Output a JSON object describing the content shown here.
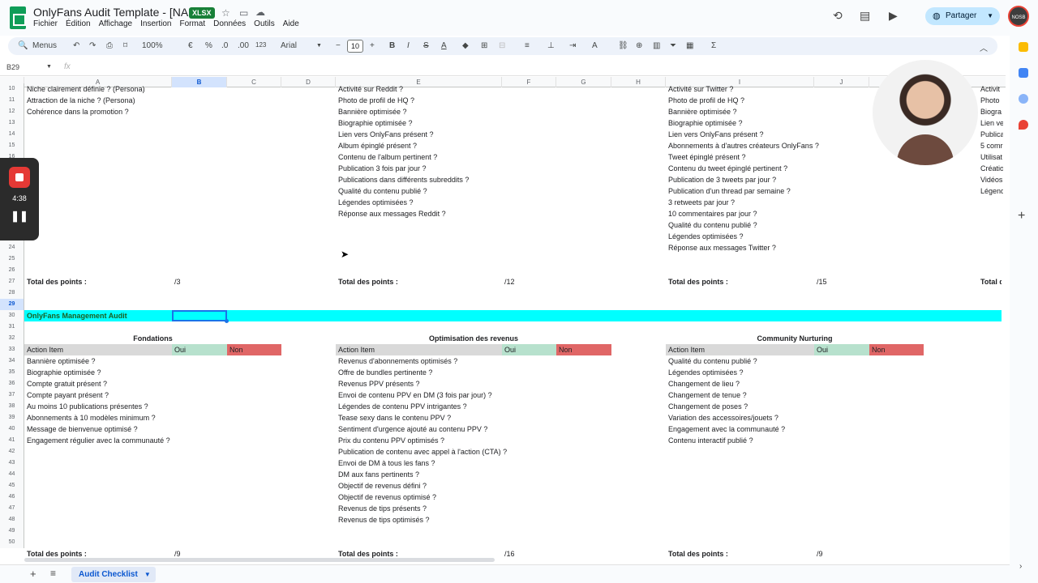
{
  "app": {
    "doc_title": "OnlyFans Audit Template - [NAME]",
    "file_badge": "XLSX",
    "menu": [
      "Fichier",
      "Édition",
      "Affichage",
      "Insertion",
      "Format",
      "Données",
      "Outils",
      "Aide"
    ],
    "share_label": "Partager",
    "avatar_text": "NOSB"
  },
  "toolbar": {
    "search_label": "Menus",
    "zoom": "100%",
    "currency": "€",
    "percent": "%",
    "dec_less": ".0",
    "dec_more": ".00",
    "number_format": "123",
    "font": "Arial",
    "font_size": "10",
    "minus": "−",
    "plus": "+"
  },
  "formula_bar": {
    "cell_ref": "B29",
    "fx": "fx",
    "value": ""
  },
  "columns": [
    "A",
    "B",
    "C",
    "D",
    "E",
    "F",
    "G",
    "H",
    "I",
    "J"
  ],
  "selected_column": "B",
  "rows": [
    "10",
    "11",
    "12",
    "13",
    "14",
    "15",
    "16",
    "17",
    "18",
    "19",
    "20",
    "21",
    "22",
    "23",
    "24",
    "25",
    "26",
    "27",
    "28",
    "29",
    "30",
    "31",
    "32",
    "33",
    "34",
    "35",
    "36",
    "37",
    "38",
    "39",
    "40",
    "41",
    "42",
    "43",
    "44",
    "45",
    "46",
    "47",
    "48",
    "49",
    "50"
  ],
  "selected_row": "29",
  "top": {
    "col_a": [
      "Niche clairement définie ? (Persona)",
      "Attraction de la niche ? (Persona)",
      "Cohérence dans la promotion ?"
    ],
    "col_e": [
      "Activité sur Reddit ?",
      "Photo de profil de HQ ?",
      "Bannière optimisée ?",
      "Biographie optimisée ?",
      "Lien vers OnlyFans présent ?",
      "Album épinglé présent ?",
      "Contenu de l'album pertinent ?",
      "Publication 3 fois par jour ?",
      "Publications dans différents subreddits ?",
      "Qualité du contenu publié ?",
      "Légendes optimisées ?",
      "Réponse aux messages Reddit ?"
    ],
    "col_i": [
      "Activité sur Twitter ?",
      "Photo de profil de HQ ?",
      "Bannière optimisée ?",
      "Biographie optimisée ?",
      "Lien vers OnlyFans présent ?",
      "Abonnements à d'autres créateurs OnlyFans ?",
      "Tweet épinglé présent ?",
      "Contenu du tweet épinglé pertinent ?",
      "Publication de 3 tweets par jour ?",
      "Publication d'un thread par semaine ?",
      "3 retweets par jour ?",
      "10 commentaires par jour ?",
      "Qualité du contenu publié ?",
      "Légendes optimisées ?",
      "Réponse aux messages Twitter ?"
    ],
    "col_k": [
      "Activit",
      "Photo",
      "Biogra",
      "Lien ve",
      "Publica",
      "5 comr",
      "Utilisat",
      "Créatio",
      "Vidéos",
      "Légend"
    ],
    "totals_label": "Total des points :",
    "total_b": "/3",
    "total_f": "/12",
    "total_j": "/15",
    "total_k": "Total d"
  },
  "section_title": "OnlyFans Management Audit",
  "blocks": {
    "headers": [
      "Fondations",
      "Optimisation des revenus",
      "Community Nurturing"
    ],
    "action_item": "Action Item",
    "oui": "Oui",
    "non": "Non",
    "fondations": [
      "Photo de profil de HQ ?",
      "Bannière optimisée ?",
      "Biographie optimisée ?",
      "Compte gratuit présent ?",
      "Compte payant présent ?",
      "Au moins 10 publications présentes ?",
      "Abonnements à 10 modèles minimum ?",
      "Message de bienvenue optimisé ?",
      "Engagement régulier avec la communauté ?"
    ],
    "revenus": [
      "Revenus d'abonnements présents ?",
      "Revenus d'abonnements optimisés ?",
      "Offre de bundles pertinente ?",
      "Revenus PPV présents ?",
      "Envoi de contenu PPV en DM (3 fois par jour) ?",
      "Légendes de contenu PPV intrigantes ?",
      "Tease sexy dans le contenu PPV ?",
      "Sentiment d'urgence ajouté au contenu PPV ?",
      "Prix du contenu PPV optimisés ?",
      "Publication de contenu avec appel à l'action (CTA) ?",
      "Envoi de DM à tous les fans ?",
      "DM aux fans pertinents ?",
      "Objectif de revenus défini ?",
      "Objectif de revenus optimisé ?",
      "Revenus de tips présents ?",
      "Revenus de tips optimisés ?"
    ],
    "community": [
      "Publication 2 fois par jour ?",
      "Qualité du contenu publié ?",
      "Légendes optimisées ?",
      "Changement de lieu ?",
      "Changement de tenue ?",
      "Changement de poses ?",
      "Variation des accessoires/jouets ?",
      "Engagement avec la communauté ?",
      "Contenu interactif publié ?"
    ],
    "total_b": "/9",
    "total_f": "/16",
    "total_j": "/9"
  },
  "recorder": {
    "time": "4:38"
  },
  "sheet_tab": "Audit Checklist",
  "colors": {
    "band": "#00ffff",
    "oui": "#b7e1cd",
    "non": "#e06666",
    "selection": "#1a73e8"
  }
}
